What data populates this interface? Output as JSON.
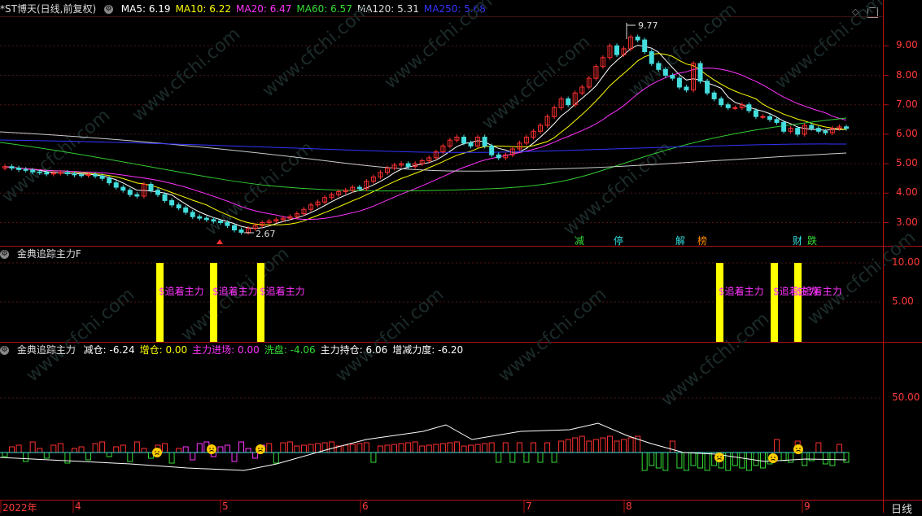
{
  "main_panel": {
    "stock_title": "*ST博天(日线,前复权)",
    "ma_labels": [
      {
        "label": "MA5: 6.19",
        "color": "#ffffff"
      },
      {
        "label": "MA10: 6.22",
        "color": "#ffff00"
      },
      {
        "label": "MA20: 6.47",
        "color": "#ff33ff"
      },
      {
        "label": "MA60: 6.57",
        "color": "#33dd33"
      },
      {
        "label": "MA120: 5.31",
        "color": "#dddddd"
      },
      {
        "label": "MA250: 5.68",
        "color": "#3333ff"
      }
    ],
    "high_label": "9.77",
    "low_label": "2.67",
    "price_axis": [
      "9.00",
      "8.00",
      "7.00",
      "6.00",
      "5.00",
      "4.00",
      "3.00"
    ],
    "event_tags": [
      {
        "label": "减",
        "color": "#33dd33"
      },
      {
        "label": "停",
        "color": "#33dddd"
      },
      {
        "label": "解",
        "color": "#33dddd"
      },
      {
        "label": "榜",
        "color": "#ff8800"
      },
      {
        "label": "财",
        "color": "#33dddd"
      },
      {
        "label": "跌",
        "color": "#33dd33"
      }
    ]
  },
  "signal_panel": {
    "title": "金典追踪主力F",
    "axis": [
      "10.00",
      "5.00"
    ],
    "signal_text": "$追着主力",
    "signal_count": 6
  },
  "bottom_panel": {
    "title": "金典追踪主力",
    "values": [
      {
        "label": "减仓: -6.24",
        "color": "#ffffff"
      },
      {
        "label": "增仓: 0.00",
        "color": "#ffff00"
      },
      {
        "label": "主力进场: 0.00",
        "color": "#ff33ff"
      },
      {
        "label": "洗盘: -4.06",
        "color": "#33dd33"
      },
      {
        "label": "主力持仓: 6.06",
        "color": "#ffffff"
      },
      {
        "label": "增减力度: -6.20",
        "color": "#ffffff"
      }
    ],
    "axis": [
      "50.00"
    ]
  },
  "time_axis": {
    "labels": [
      "2022年",
      "4",
      "5",
      "6",
      "7",
      "8",
      "9"
    ],
    "period": "日线"
  },
  "watermark": "www.cfchi.com",
  "chart_data": {
    "type": "candlestick",
    "title": "*ST博天(日线,前复权)",
    "ylim": [
      2.5,
      10.2
    ],
    "ma_values": {
      "MA5": 6.19,
      "MA10": 6.22,
      "MA20": 6.47,
      "MA60": 6.57,
      "MA120": 5.31,
      "MA250": 5.68
    },
    "high": 9.77,
    "low": 2.67,
    "x_ticks": [
      "2022年",
      "4",
      "5",
      "6",
      "7",
      "8",
      "9"
    ]
  }
}
